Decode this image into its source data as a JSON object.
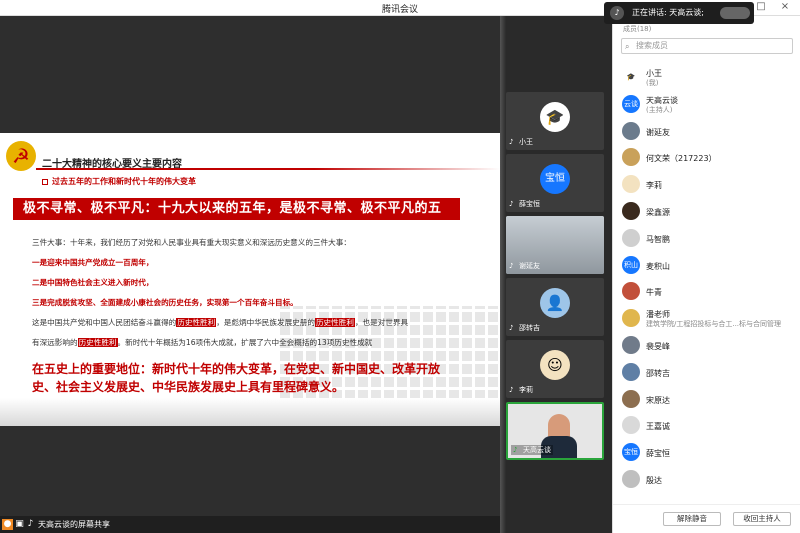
{
  "window": {
    "title": "腾讯会议"
  },
  "speaking": {
    "text": "正在讲话: 天高云谈;"
  },
  "slide": {
    "title": "二十大精神的核心要义主要内容",
    "subheading": "过去五年的工作和新时代十年的伟大变革",
    "banner": "极不寻常、极不平凡：十九大以来的五年，是极不寻常、极不平凡的五年。",
    "intro": "三件大事：十年来，我们经历了对党和人民事业具有重大现实意义和深远历史意义的三件大事：",
    "point1": "一是迎来中国共产党成立一百周年，",
    "point2": "二是中国特色社会主义进入新时代，",
    "point3": "三是完成脱贫攻坚、全面建成小康社会的历史任务，实现第一个百年奋斗目标。",
    "p4_a": "这是中国共产党和中国人民团结奋斗赢得的",
    "p4_hl1": "历史性胜利",
    "p4_b": "，是彪炳中华民族发展史册的",
    "p4_hl2": "历史性胜利",
    "p4_c": "，也是对世界具",
    "p5_a": "有深远影响的",
    "p5_hl": "历史性胜利",
    "p5_b": "。新时代十年概括为16项伟大成就，扩展了六中全会概括的13项历史性成就",
    "bigred": "在五史上的重要地位：新时代十年的伟大变革，在党史、新中国史、改革开放史、社会主义发展史、中华民族发展史上具有里程碑意义。"
  },
  "bottombar": {
    "share_text": "天高云谈的屏幕共享"
  },
  "tiles": [
    {
      "name": "小王",
      "avatar": "cap-icon"
    },
    {
      "name": "薛宝恒",
      "avatar_text": "宝恒",
      "color": "#1677ff"
    },
    {
      "name": "谢延友",
      "type": "video"
    },
    {
      "name": "邵转吉",
      "avatar": "person-icon"
    },
    {
      "name": "李莉",
      "avatar": "cartoon-icon"
    },
    {
      "name": "天高云谈",
      "type": "self"
    }
  ],
  "members": {
    "header": "成员(18)",
    "search_placeholder": "搜索成员",
    "items": [
      {
        "name": "小王",
        "sub": "(我)",
        "color": "#ffffff",
        "avatar": "cap-icon"
      },
      {
        "name": "天高云谈",
        "sub": "(主持人)",
        "color": "#1677ff",
        "avatar_text": "云谈"
      },
      {
        "name": "谢延友",
        "color": "#6b7b8c"
      },
      {
        "name": "何文荣（217223）",
        "color": "#c9a15a"
      },
      {
        "name": "李莉",
        "color": "#f3e2c0"
      },
      {
        "name": "梁鑫源",
        "color": "#3a2a1e"
      },
      {
        "name": "马智鹏",
        "color": "#cfcfcf"
      },
      {
        "name": "麦积山",
        "color": "#1677ff",
        "avatar_text": "积山"
      },
      {
        "name": "牛青",
        "color": "#c2503a"
      },
      {
        "name": "潘老师",
        "sub": "建筑学院/工程招投标与合工...标与合同管理",
        "color": "#e0b64d"
      },
      {
        "name": "裴旻峰",
        "color": "#707b8a"
      },
      {
        "name": "邵转吉",
        "color": "#5f7fa5"
      },
      {
        "name": "宋原达",
        "color": "#8c6e4f"
      },
      {
        "name": "王嘉诚",
        "color": "#d9d9d9"
      },
      {
        "name": "薛宝恒",
        "color": "#1677ff",
        "avatar_text": "宝恒"
      },
      {
        "name": "殷达",
        "color": "#bfbfbf"
      }
    ]
  },
  "buttons": {
    "mute_all": "解除静音",
    "revoke_host": "收回主持人"
  }
}
